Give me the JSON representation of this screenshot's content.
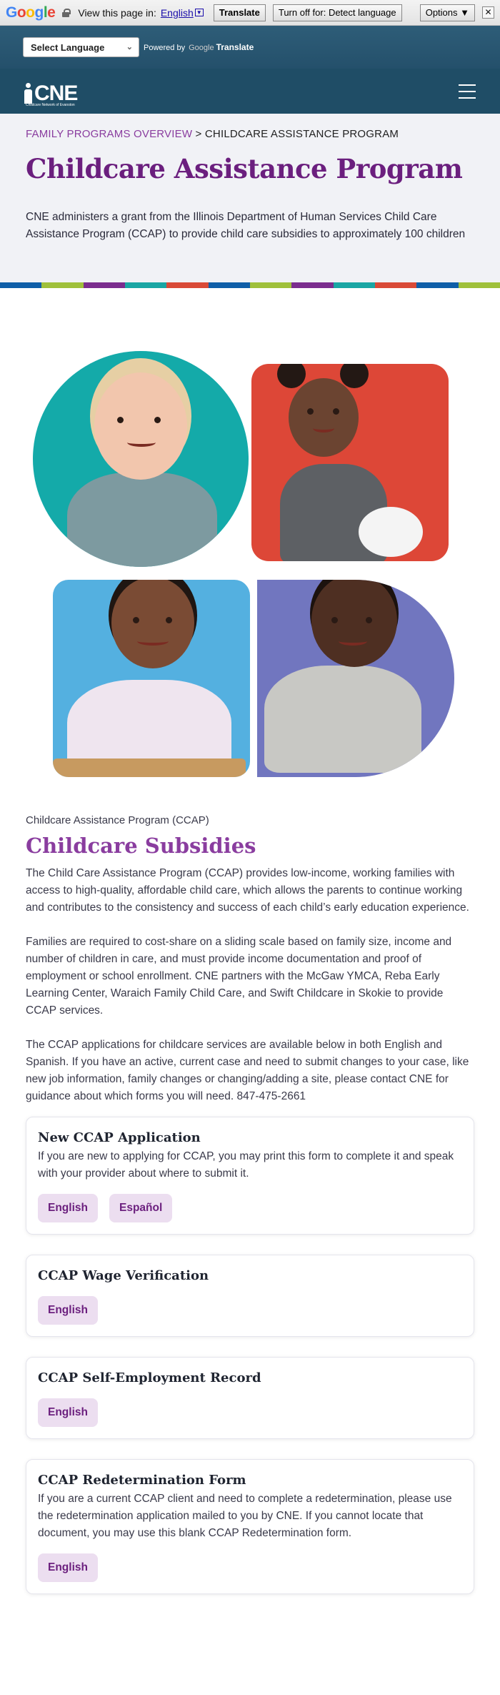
{
  "google_bar": {
    "logo": [
      "G",
      "o",
      "o",
      "g",
      "l",
      "e"
    ],
    "view_text": "View this page in:",
    "language": "English",
    "dropdown_glyph": "▼",
    "translate_label": "Translate",
    "turn_off_label": "Turn off for: Detect language",
    "options_label": "Options ▼",
    "close_glyph": "✕"
  },
  "language_bar": {
    "select_label": "Select Language",
    "select_chevron": "⌄",
    "powered_by": "Powered by",
    "google": "Google",
    "translate": "Translate"
  },
  "header": {
    "logo_text": "CNE",
    "logo_sub": "Childcare Network of Evanston",
    "menu_icon": "hamburger-icon"
  },
  "hero": {
    "breadcrumb_parent": "FAMILY PROGRAMS OVERVIEW",
    "breadcrumb_sep": " > ",
    "breadcrumb_current": "CHILDCARE ASSISTANCE PROGRAM",
    "title": "Childcare Assistance Program",
    "intro": "CNE administers a grant from the Illinois Department of Human Services Child Care Assistance Program (CCAP) to provide child care subsidies to approximately 100 children"
  },
  "strip_colors": [
    "#0f5ea8",
    "#9fc03b",
    "#7b2d8e",
    "#1aa6a4",
    "#d94a37",
    "#0f5ea8",
    "#9fc03b",
    "#7b2d8e",
    "#1aa6a4",
    "#d94a37",
    "#0f5ea8",
    "#9fc03b"
  ],
  "main": {
    "kicker": "Childcare Assistance Program (CCAP)",
    "title": "Childcare Subsidies",
    "paragraphs": [
      "The Child Care Assistance Program (CCAP) provides low-income, working families with access to high-quality, affordable child care, which allows the parents to continue working and contributes to the consistency and success of each child’s early education experience.",
      "Families are required to cost-share on a sliding scale based on family size, income and number of children in care, and must provide income documentation and proof of employment or school enrollment. CNE partners with the McGaw YMCA, Reba Early Learning Center, Waraich Family Child Care, and Swift Childcare in Skokie to provide CCAP services.",
      "The CCAP applications for childcare services are available below in both English and Spanish. If you have an active, current case and need to submit changes to your case, like new job information, family changes or changing/adding a site, please contact CNE for guidance about which forms you will need. 847-475-2661"
    ]
  },
  "cards": [
    {
      "title": "New CCAP Application",
      "desc": "If you are new to applying for CCAP, you may print this form to complete it and speak with your provider about where to submit it.",
      "buttons": [
        "English",
        "Español"
      ]
    },
    {
      "title": "CCAP Wage Verification",
      "desc": "",
      "buttons": [
        "English"
      ]
    },
    {
      "title": "CCAP Self-Employment Record",
      "desc": "",
      "buttons": [
        "English"
      ]
    },
    {
      "title": "CCAP Redetermination Form",
      "desc": "If you are a current CCAP client and need to complete a redetermination, please use the redetermination application mailed to you by CNE. If you cannot locate that document, you may use this blank CCAP Redetermination form.",
      "buttons": [
        "English"
      ]
    }
  ]
}
